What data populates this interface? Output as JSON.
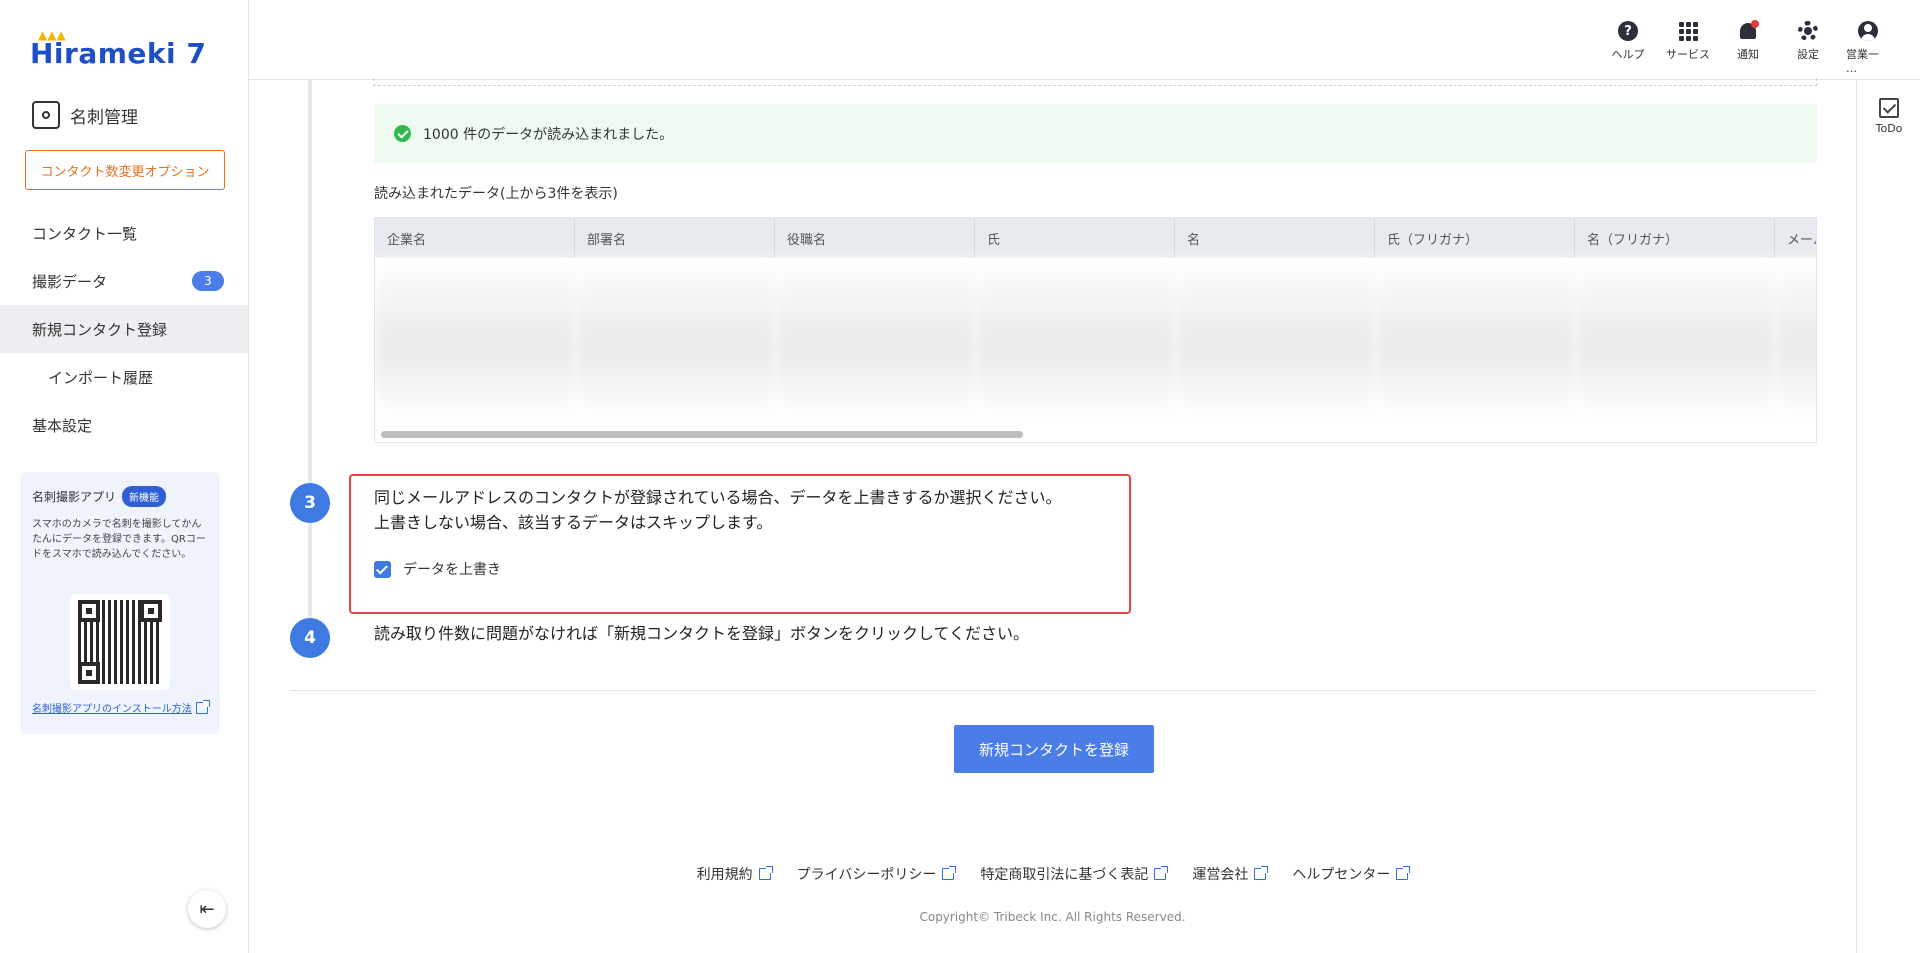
{
  "brand": {
    "logo_text": "Hirameki 7",
    "module": "名刺管理"
  },
  "sidebar": {
    "option_button": "コンタクト数変更オプション",
    "items": [
      {
        "label": "コンタクト一覧"
      },
      {
        "label": "撮影データ",
        "badge": "3"
      },
      {
        "label": "新規コンタクト登録"
      },
      {
        "label": "インポート履歴"
      },
      {
        "label": "基本設定"
      }
    ],
    "app_card": {
      "title": "名刺撮影アプリ",
      "badge": "新機能",
      "description": "スマホのカメラで名刺を撮影してかんたんにデータを登録できます。QRコードをスマホで読み込んでください。",
      "link": "名刺撮影アプリのインストール方法"
    }
  },
  "header": {
    "icons": [
      {
        "label": "ヘルプ",
        "icon": "help-icon"
      },
      {
        "label": "サービス",
        "icon": "apps-grid-icon"
      },
      {
        "label": "通知",
        "icon": "bell-icon"
      },
      {
        "label": "設定",
        "icon": "gear-icon"
      },
      {
        "label": "営業一 …",
        "icon": "user-icon"
      }
    ]
  },
  "right_rail": {
    "todo_label": "ToDo"
  },
  "main": {
    "success_message": "1000 件のデータが読み込まれました。",
    "table_caption": "読み込まれたデータ(上から3件を表示)",
    "table_headers": [
      "企業名",
      "部署名",
      "役職名",
      "氏",
      "名",
      "氏（フリガナ）",
      "名（フリガナ）",
      "メール"
    ],
    "step3": {
      "number": "3",
      "line1": "同じメールアドレスのコンタクトが登録されている場合、データを上書きするか選択ください。",
      "line2": "上書きしない場合、該当するデータはスキップします。",
      "checkbox_label": "データを上書き"
    },
    "step4": {
      "number": "4",
      "text": "読み取り件数に問題がなければ「新規コンタクトを登録」ボタンをクリックしてください。"
    },
    "register_button": "新規コンタクトを登録"
  },
  "footer": {
    "links": [
      "利用規約",
      "プライバシーポリシー",
      "特定商取引法に基づく表記",
      "運営会社",
      "ヘルプセンター"
    ],
    "copyright": "Copyright© Tribeck Inc. All Rights Reserved."
  }
}
